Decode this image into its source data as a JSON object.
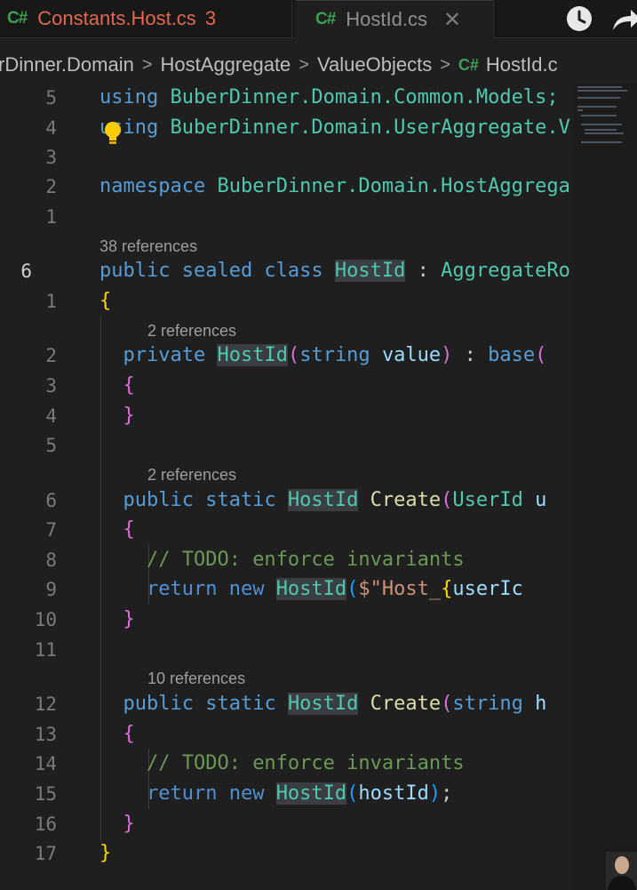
{
  "tabs": [
    {
      "icon": "csharp-icon",
      "label": "Constants.Host.cs",
      "problems": "3"
    },
    {
      "icon": "csharp-icon",
      "label": "HostId.cs",
      "close": "✕"
    }
  ],
  "breadcrumb": {
    "items": [
      "rDinner.Domain",
      "HostAggregate",
      "ValueObjects",
      "HostId.c"
    ],
    "file_icon": "C#"
  },
  "editor": {
    "line_numbers": [
      "5",
      "4",
      "3",
      "2",
      "1",
      "6",
      "1",
      "2",
      "3",
      "4",
      "5",
      "6",
      "7",
      "8",
      "9",
      "10",
      "11",
      "12",
      "13",
      "14",
      "15",
      "16",
      "17"
    ],
    "code_lens": [
      "38 references",
      "2 references",
      "2 references",
      "10 references"
    ],
    "code_text": {
      "using1_kw": "using",
      "using1_ns": "BuberDinner.Domain.Common.Models;",
      "using2_kw": "using",
      "using2_ns": "BuberDinner.Domain.UserAggregate.V",
      "ns_kw": "namespace",
      "ns_name": "BuberDinner.Domain.HostAggrega",
      "class_mods": "public sealed class",
      "class_name": "HostId",
      "class_rest_op": ":",
      "class_base": "AggregateRo",
      "ctor_mod": "private",
      "ctor_name": "HostId",
      "ctor_paren": "(",
      "ctor_type": "string",
      "ctor_param": "value",
      "ctor_paren_close": ")",
      "ctor_colon": ":",
      "ctor_base": "base",
      "ctor_base_paren": "(",
      "m1_mods": "public static",
      "m1_type": "HostId",
      "m1_name": "Create",
      "m1_paren": "(",
      "m1_ptype": "UserId",
      "m1_param": "u",
      "comment": "// TODO: enforce invariants",
      "ret1_kw": "return new",
      "ret1_type": "HostId",
      "ret1_paren": "(",
      "ret1_str": "$\"Host_",
      "ret1_brace": "{",
      "ret1_var": "userIc",
      "m2_mods": "public static",
      "m2_type": "HostId",
      "m2_name": "Create",
      "m2_paren": "(",
      "m2_ptype": "string",
      "m2_param": "h",
      "ret2_kw": "return new",
      "ret2_type": "HostId",
      "ret2_paren": "(",
      "ret2_arg": "hostId",
      "ret2_close": ")",
      "ret2_semi": ";",
      "brace_open": "{",
      "brace_close": "}"
    }
  },
  "colors": {
    "keyword": "#569cd6",
    "type": "#4ec9b0",
    "function": "#dcdcaa",
    "parameter": "#9cdcfe",
    "string": "#ce9178",
    "comment": "#6a9955",
    "bracket_level1": "#ffd700",
    "bracket_level2": "#da70d6",
    "tab_error": "#e0694f",
    "csharp_icon": "#3aa155"
  },
  "icons": [
    "history-icon",
    "forward-icon",
    "lightbulb-icon",
    "close-icon",
    "csharp-icon"
  ]
}
